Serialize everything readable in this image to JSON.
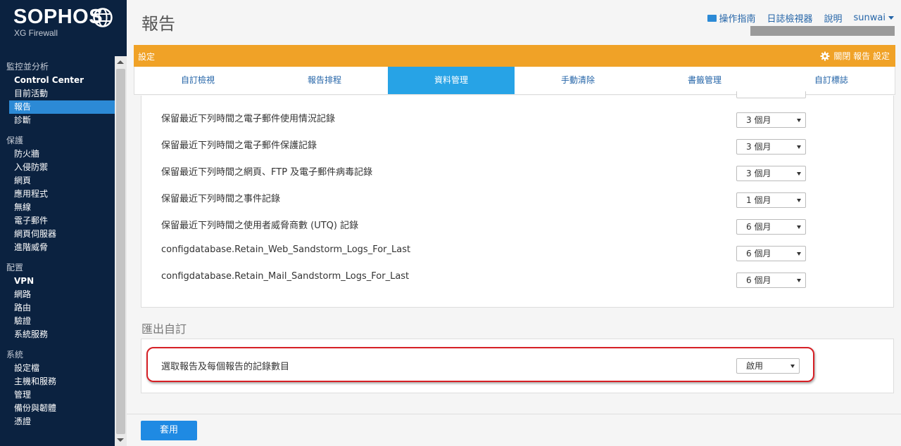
{
  "brand": {
    "name": "SOPHOS",
    "product": "XG Firewall"
  },
  "sidebar": {
    "sections": [
      {
        "title": "監控並分析",
        "items": [
          {
            "label": "Control Center",
            "bold": true
          },
          {
            "label": "目前活動"
          },
          {
            "label": "報告",
            "active": true
          },
          {
            "label": "診斷"
          }
        ]
      },
      {
        "title": "保護",
        "items": [
          {
            "label": "防火牆"
          },
          {
            "label": "入侵防禦"
          },
          {
            "label": "網頁"
          },
          {
            "label": "應用程式"
          },
          {
            "label": "無線"
          },
          {
            "label": "電子郵件"
          },
          {
            "label": "網頁伺服器"
          },
          {
            "label": "進階威脅"
          }
        ]
      },
      {
        "title": "配置",
        "items": [
          {
            "label": "VPN",
            "bold": true
          },
          {
            "label": "網路"
          },
          {
            "label": "路由"
          },
          {
            "label": "驗證"
          },
          {
            "label": "系統服務"
          }
        ]
      },
      {
        "title": "系統",
        "items": [
          {
            "label": "設定檔"
          },
          {
            "label": "主機和服務"
          },
          {
            "label": "管理"
          },
          {
            "label": "備份與韌體"
          },
          {
            "label": "憑證"
          }
        ]
      }
    ]
  },
  "header": {
    "title": "報告",
    "links": {
      "guide": "操作指南",
      "log_viewer": "日誌檢視器",
      "help": "說明",
      "user": "sunwai"
    }
  },
  "settings_bar": {
    "label": "設定",
    "close_label": "關閉 報告 設定"
  },
  "tabs": [
    {
      "label": "自訂檢視"
    },
    {
      "label": "報告排程"
    },
    {
      "label": "資料管理",
      "active": true
    },
    {
      "label": "手動清除"
    },
    {
      "label": "書籤管理"
    },
    {
      "label": "自訂標誌"
    }
  ],
  "retention": [
    {
      "label": "保留最近下列時間之電子郵件使用情況記錄",
      "value": "3 個月"
    },
    {
      "label": "保留最近下列時間之電子郵件保護記錄",
      "value": "3 個月"
    },
    {
      "label": "保留最近下列時間之網頁、FTP 及電子郵件病毒記錄",
      "value": "3 個月"
    },
    {
      "label": "保留最近下列時間之事件記錄",
      "value": "1 個月"
    },
    {
      "label": "保留最近下列時間之使用者威脅商數 (UTQ) 記錄",
      "value": "6 個月"
    },
    {
      "label": "configdatabase.Retain_Web_Sandstorm_Logs_For_Last",
      "value": "6 個月"
    },
    {
      "label": "configdatabase.Retain_Mail_Sandstorm_Logs_For_Last",
      "value": "6 個月"
    }
  ],
  "export": {
    "title": "匯出自訂",
    "label": "選取報告及每個報告的記錄數目",
    "value": "啟用"
  },
  "apply_label": "套用",
  "colors": {
    "sidebar": "#0b2240",
    "accent_orange": "#f0a227",
    "active_tab": "#27a3e6",
    "highlight": "#d61f25"
  }
}
